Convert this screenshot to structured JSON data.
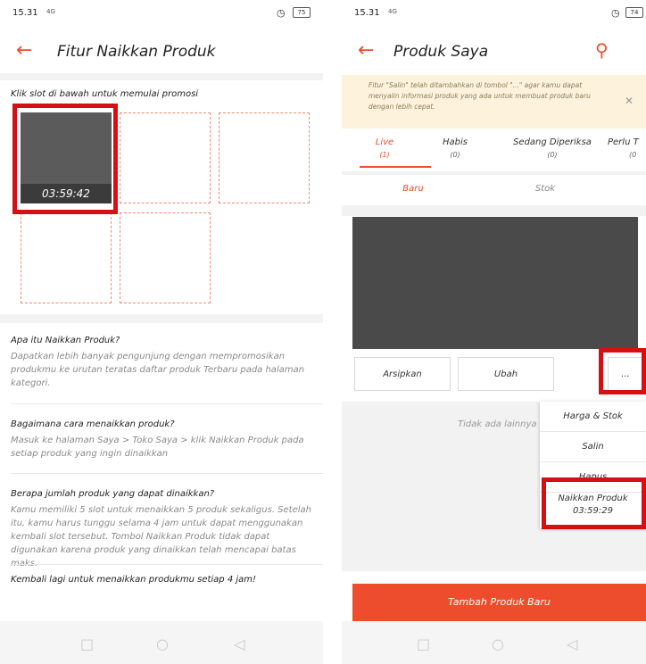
{
  "left": {
    "status": {
      "time": "15.31",
      "signal": "4G",
      "battery": "75"
    },
    "title": "Fitur Naikkan Produk",
    "instruction": "Klik slot di bawah untuk memulai promosi",
    "slot_timer": "03:59:42",
    "faq": [
      {
        "q": "Apa itu Naikkan Produk?",
        "a": "Dapatkan lebih banyak pengunjung dengan mempromosikan produkmu ke urutan teratas daftar produk Terbaru pada halaman kategori."
      },
      {
        "q": "Bagaimana cara menaikkan produk?",
        "a": "Masuk ke halaman Saya > Toko Saya > klik Naikkan Produk pada setiap produk yang ingin dinaikkan"
      },
      {
        "q": "Berapa jumlah produk yang dapat dinaikkan?",
        "a": "Kamu memiliki 5 slot untuk menaikkan 5 produk sekaligus. Setelah itu, kamu harus tunggu selama 4 jam untuk dapat menggunakan kembali slot tersebut. Tombol Naikkan Produk tidak dapat digunakan karena produk yang dinaikkan telah mencapai batas maks."
      }
    ],
    "footer_text": "Kembali lagi untuk menaikkan produkmu setiap 4 jam!"
  },
  "right": {
    "status": {
      "time": "15.31",
      "signal": "4G",
      "battery": "74"
    },
    "title": "Produk Saya",
    "banner": "Fitur \"Salin\" telah ditambahkan di tombol \"...\" agar kamu dapat menyalin informasi produk yang ada untuk membuat produk baru dengan lebih cepat.",
    "tabs": [
      {
        "label": "Live",
        "count": "(1)"
      },
      {
        "label": "Habis",
        "count": "(0)"
      },
      {
        "label": "Sedang Diperiksa",
        "count": "(0)"
      },
      {
        "label": "Perlu T",
        "count": "(0"
      }
    ],
    "subtabs": [
      "Baru",
      "Stok"
    ],
    "buttons": {
      "archive": "Arsipkan",
      "edit": "Ubah",
      "more": "..."
    },
    "empty_text": "Tidak ada lainnya",
    "menu": [
      "Harga & Stok",
      "Salin",
      "Hapus"
    ],
    "menu_boost": {
      "label": "Naikkan Produk",
      "timer": "03:59:29"
    },
    "cta": "Tambah Produk Baru"
  },
  "colors": {
    "accent": "#ee4d2d",
    "highlight": "#d60f14",
    "banner": "#fdf3dd"
  }
}
